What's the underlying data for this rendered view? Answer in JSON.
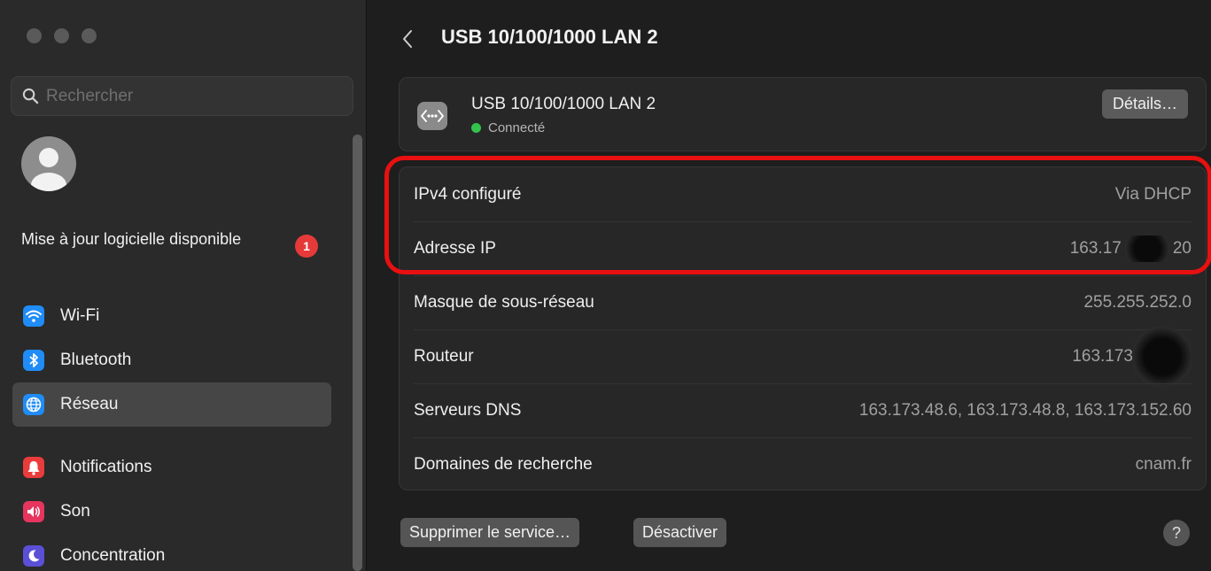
{
  "sidebar": {
    "search": {
      "placeholder": "Rechercher"
    },
    "update": {
      "label": "Mise à jour logicielle disponible",
      "badge": "1"
    },
    "items": [
      {
        "label": "Wi-Fi",
        "icon": "wifi-icon",
        "color": "#1f8cf7"
      },
      {
        "label": "Bluetooth",
        "icon": "bluetooth-icon",
        "color": "#1f8cf7"
      },
      {
        "label": "Réseau",
        "icon": "globe-icon",
        "color": "#1f8cf7",
        "selected": true
      },
      {
        "label": "Notifications",
        "icon": "bell-icon",
        "color": "#ea3c3c"
      },
      {
        "label": "Son",
        "icon": "speaker-icon",
        "color": "#e6355e"
      },
      {
        "label": "Concentration",
        "icon": "moon-icon",
        "color": "#5b4fd6"
      }
    ]
  },
  "main": {
    "title": "USB 10/100/1000 LAN 2",
    "service": {
      "name": "USB 10/100/1000 LAN 2",
      "status": "Connecté",
      "status_color": "#32c24d",
      "details_label": "Détails…"
    },
    "rows": [
      {
        "label": "IPv4 configuré",
        "value": "Via DHCP"
      },
      {
        "label": "Adresse IP",
        "value_prefix": "163.17",
        "value_suffix": "20"
      },
      {
        "label": "Masque de sous-réseau",
        "value": "255.255.252.0"
      },
      {
        "label": "Routeur",
        "value_prefix": "163.173"
      },
      {
        "label": "Serveurs DNS",
        "value": "163.173.48.6, 163.173.48.8, 163.173.152.60"
      },
      {
        "label": "Domaines de recherche",
        "value": "cnam.fr"
      }
    ],
    "buttons": {
      "delete_service": "Supprimer le service…",
      "deactivate": "Désactiver",
      "help": "?"
    },
    "highlight_color": "#e81010"
  }
}
